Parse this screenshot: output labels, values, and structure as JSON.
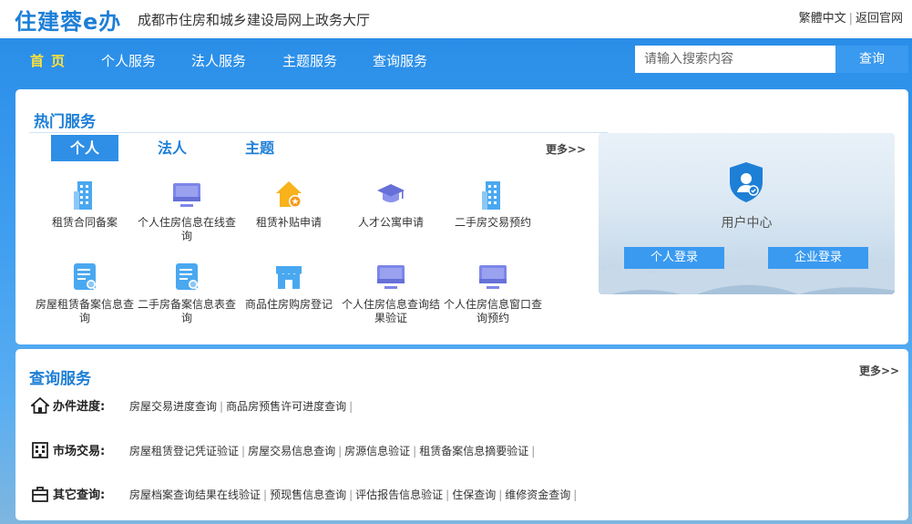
{
  "header": {
    "logo": "住建蓉e办",
    "subtitle": "成都市住房和城乡建设局网上政务大厅",
    "links": [
      "繁體中文",
      "返回官网"
    ]
  },
  "nav": {
    "items": [
      "首页",
      "个人服务",
      "法人服务",
      "主题服务",
      "查询服务"
    ],
    "search_placeholder": "请输入搜索内容",
    "search_button": "查询"
  },
  "hot": {
    "title": "热门服务",
    "tabs": [
      "个人",
      "法人",
      "主题"
    ],
    "more": "更多>>",
    "services": [
      {
        "label": "租赁合同备案",
        "icon": "building-icon"
      },
      {
        "label": "个人住房信息在线查询",
        "icon": "monitor-icon"
      },
      {
        "label": "租赁补贴申请",
        "icon": "house-icon"
      },
      {
        "label": "人才公寓申请",
        "icon": "graduation-cap-icon"
      },
      {
        "label": "二手房交易预约",
        "icon": "building-icon"
      },
      {
        "label": "房屋租赁备案信息查询",
        "icon": "document-search-icon"
      },
      {
        "label": "二手房备案信息表查询",
        "icon": "document-search-icon"
      },
      {
        "label": "商品住房购房登记",
        "icon": "store-icon"
      },
      {
        "label": "个人住房信息查询结果验证",
        "icon": "monitor-icon"
      },
      {
        "label": "个人住房信息窗口查询预约",
        "icon": "monitor-icon"
      }
    ]
  },
  "user_center": {
    "title": "用户中心",
    "personal_login": "个人登录",
    "company_login": "企业登录"
  },
  "query": {
    "title": "查询服务",
    "more": "更多>>",
    "rows": [
      {
        "category": "办件进度:",
        "icon": "house-outline-icon",
        "links": [
          "房屋交易进度查询",
          "商品房预售许可进度查询"
        ]
      },
      {
        "category": "市场交易:",
        "icon": "building-outline-icon",
        "links": [
          "房屋租赁登记凭证验证",
          "房屋交易信息查询",
          "房源信息验证",
          "租赁备案信息摘要验证"
        ]
      },
      {
        "category": "其它查询:",
        "icon": "briefcase-icon",
        "links": [
          "房屋档案查询结果在线验证",
          "预现售信息查询",
          "评估报告信息验证",
          "住保查询",
          "维修资金查询"
        ]
      }
    ]
  },
  "colors": {
    "brand": "#1e7fd6",
    "nav_active": "#ffe13a",
    "button": "#3a9af0"
  }
}
